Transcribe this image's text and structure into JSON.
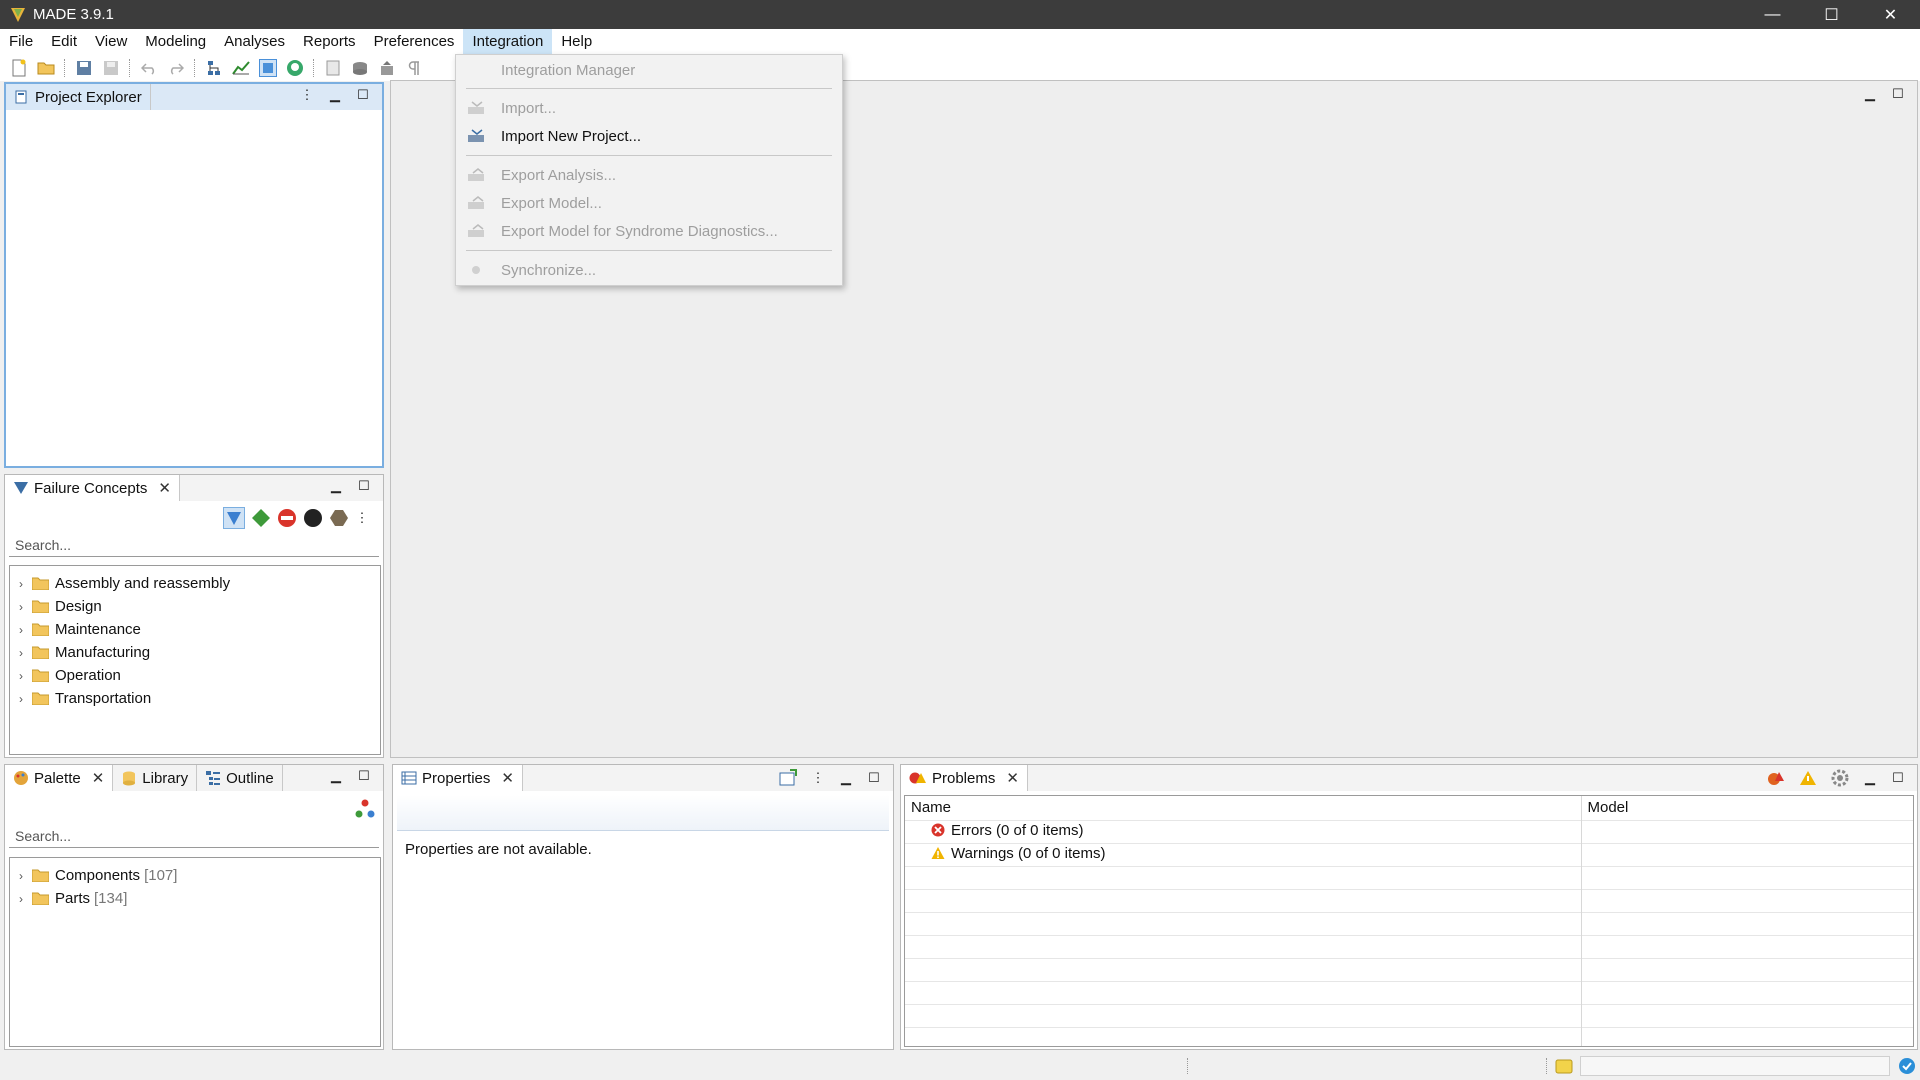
{
  "window": {
    "title": "MADE 3.9.1",
    "minimize": "—",
    "maximize": "☐",
    "close": "✕"
  },
  "menubar": [
    "File",
    "Edit",
    "View",
    "Modeling",
    "Analyses",
    "Reports",
    "Preferences",
    "Integration",
    "Help"
  ],
  "integration_menu": {
    "items": [
      {
        "label": "Integration Manager",
        "enabled": false
      },
      {
        "label": "Import...",
        "enabled": false
      },
      {
        "label": "Import New Project...",
        "enabled": true
      },
      {
        "label": "Export Analysis...",
        "enabled": false
      },
      {
        "label": "Export Model...",
        "enabled": false
      },
      {
        "label": "Export Model for Syndrome Diagnostics...",
        "enabled": false
      },
      {
        "label": "Synchronize...",
        "enabled": false
      }
    ]
  },
  "project_explorer": {
    "tab": "Project Explorer"
  },
  "failure_concepts": {
    "tab": "Failure Concepts",
    "search_placeholder": "Search...",
    "folders": [
      "Assembly and reassembly",
      "Design",
      "Maintenance",
      "Manufacturing",
      "Operation",
      "Transportation"
    ]
  },
  "palette": {
    "tabs": [
      "Palette",
      "Library",
      "Outline"
    ],
    "search_placeholder": "Search...",
    "folders": [
      {
        "label": "Components",
        "count": "[107]"
      },
      {
        "label": "Parts",
        "count": "[134]"
      }
    ]
  },
  "properties": {
    "tab": "Properties",
    "message": "Properties are not available."
  },
  "problems": {
    "tab": "Problems",
    "columns": [
      "Name",
      "Model"
    ],
    "rows": [
      {
        "label": "Errors (0 of 0 items)",
        "kind": "error"
      },
      {
        "label": "Warnings (0 of 0 items)",
        "kind": "warning"
      }
    ]
  },
  "colors": {
    "accent": "#4a90d9",
    "titlebar": "#3c3c3c",
    "folder": "#f2c55c",
    "error": "#d9342b",
    "warning": "#f0b400"
  }
}
